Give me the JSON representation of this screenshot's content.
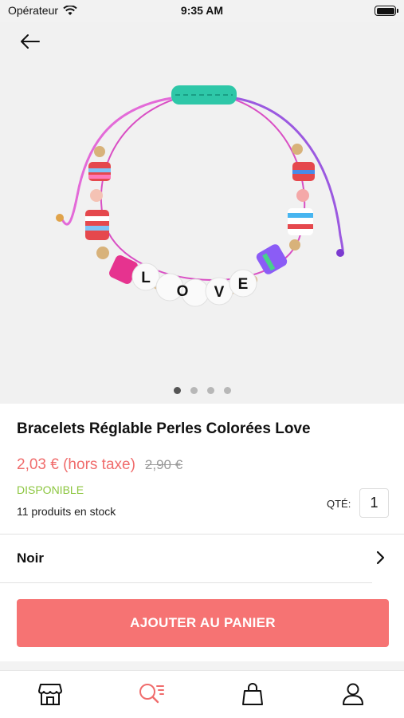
{
  "status_bar": {
    "carrier": "Opérateur",
    "time": "9:35 AM"
  },
  "product": {
    "title": "Bracelets Réglable Perles Colorées Love",
    "price": "2,03 € (hors taxe)",
    "old_price": "2,90 €",
    "availability": "DISPONIBLE",
    "stock": "11 produits en stock",
    "qty_label": "QTÉ:",
    "qty_value": "1",
    "bead_letters": [
      "L",
      "O",
      "V",
      "E"
    ],
    "gallery_dots": 4,
    "gallery_active": 0
  },
  "option": {
    "label": "Noir"
  },
  "add_to_cart": {
    "label": "AJOUTER AU PANIER"
  },
  "tab_bar": {
    "tabs": [
      "shop-icon",
      "search-list-icon",
      "cart-bag-icon",
      "profile-icon"
    ],
    "active": 1
  },
  "colors": {
    "accent": "#f67373",
    "price": "#f06c6c",
    "available": "#8cc63f",
    "active_tab": "#f06c6c"
  }
}
